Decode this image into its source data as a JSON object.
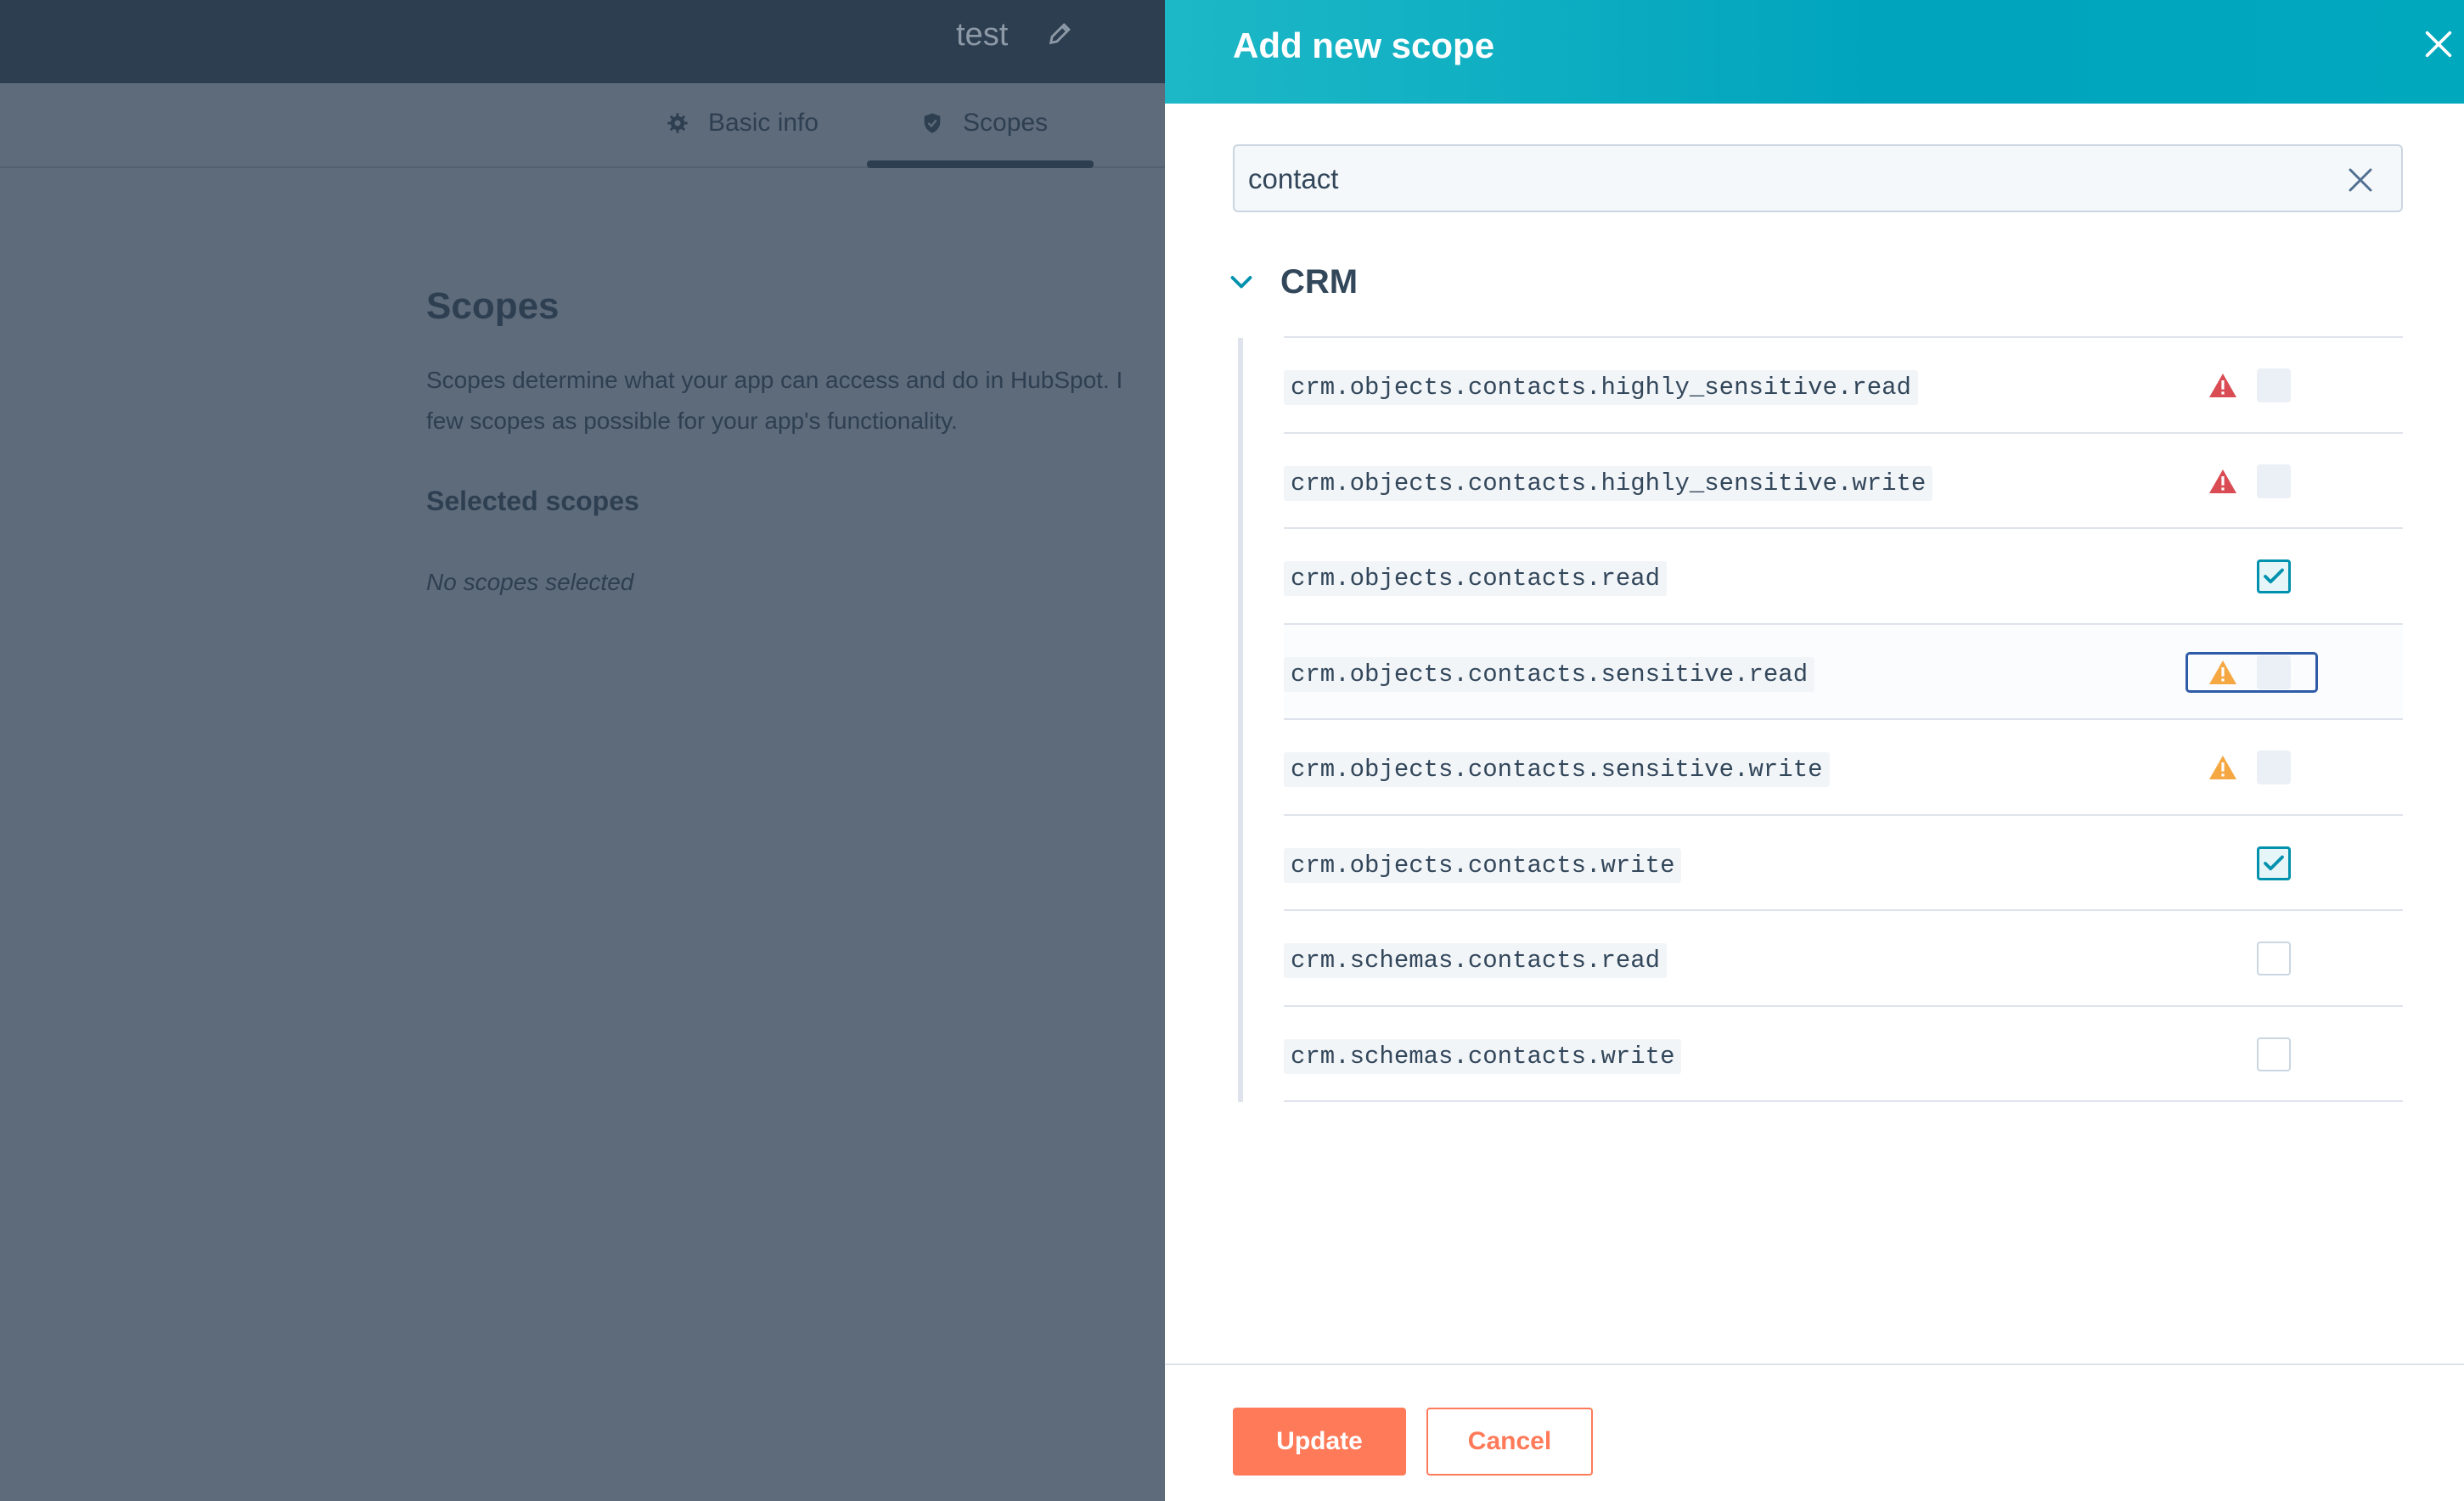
{
  "background": {
    "app_title": "test",
    "tabs": [
      {
        "label": "Basic info",
        "icon": "gear-icon"
      },
      {
        "label": "Scopes",
        "icon": "shield-icon"
      }
    ],
    "section_title": "Scopes",
    "description_line1": "Scopes determine what your app can access and do in HubSpot. I",
    "description_line2": "few scopes as possible for your app's functionality.",
    "selected_heading": "Selected scopes",
    "empty_text": "No scopes selected"
  },
  "panel": {
    "title": "Add new scope",
    "search": {
      "value": "contact"
    },
    "group": {
      "label": "CRM",
      "expanded": true
    },
    "scopes": [
      {
        "name": "crm.objects.contacts.highly_sensitive.read",
        "warning": "red",
        "state": "disabled"
      },
      {
        "name": "crm.objects.contacts.highly_sensitive.write",
        "warning": "red",
        "state": "disabled"
      },
      {
        "name": "crm.objects.contacts.read",
        "warning": "none",
        "state": "checked"
      },
      {
        "name": "crm.objects.contacts.sensitive.read",
        "warning": "orange",
        "state": "disabled",
        "focused": true
      },
      {
        "name": "crm.objects.contacts.sensitive.write",
        "warning": "orange",
        "state": "disabled"
      },
      {
        "name": "crm.objects.contacts.write",
        "warning": "none",
        "state": "checked"
      },
      {
        "name": "crm.schemas.contacts.read",
        "warning": "none",
        "state": "unchecked"
      },
      {
        "name": "crm.schemas.contacts.write",
        "warning": "none",
        "state": "unchecked"
      }
    ],
    "buttons": {
      "update": "Update",
      "cancel": "Cancel"
    }
  },
  "colors": {
    "header_teal": "#00a4bd",
    "primary_orange": "#ff7a59",
    "warning_red": "#d94c53",
    "warning_orange": "#f5a742",
    "check_teal": "#0091ae"
  }
}
